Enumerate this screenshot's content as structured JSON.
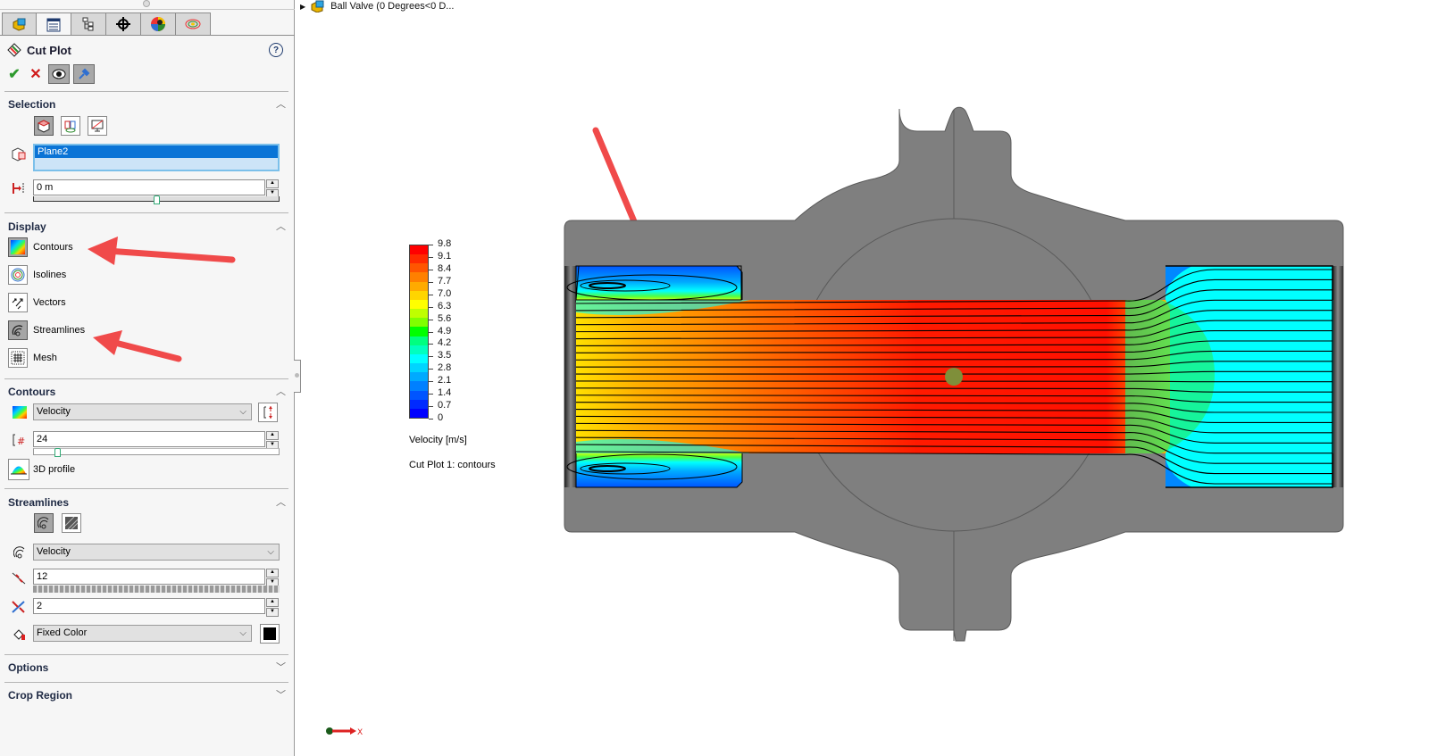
{
  "panel": {
    "tabs": [
      {
        "icon": "feature-manager-icon"
      },
      {
        "icon": "property-manager-icon",
        "active": true
      },
      {
        "icon": "configuration-manager-icon"
      },
      {
        "icon": "dimxpert-icon"
      },
      {
        "icon": "display-manager-icon"
      },
      {
        "icon": "flow-simulation-icon"
      }
    ],
    "title": "Cut Plot",
    "help_label": "?",
    "actions": {
      "ok": "✔",
      "cancel": "✕"
    },
    "selection": {
      "header": "Selection",
      "plane_value": "Plane2",
      "offset_value": "0 m",
      "offset_slider_fraction": 0.5
    },
    "display": {
      "header": "Display",
      "items": [
        {
          "label": "Contours",
          "active": true
        },
        {
          "label": "Isolines",
          "active": false
        },
        {
          "label": "Vectors",
          "active": false
        },
        {
          "label": "Streamlines",
          "active": true
        },
        {
          "label": "Mesh",
          "active": false
        }
      ]
    },
    "contours": {
      "header": "Contours",
      "parameter": "Velocity",
      "levels": "24",
      "levels_slider_fraction": 0.09,
      "profile_label": "3D profile"
    },
    "streamlines": {
      "header": "Streamlines",
      "parameter": "Velocity",
      "number_of_points": "12",
      "arrow_spacing": "2",
      "color_mode": "Fixed Color",
      "fixed_color": "#000000"
    },
    "options_header": "Options",
    "crop_header": "Crop Region"
  },
  "viewport": {
    "tree_label": "Ball Valve  (0 Degrees<0 D...",
    "legend": {
      "ticks": [
        "9.8",
        "9.1",
        "8.4",
        "7.7",
        "7.0",
        "6.3",
        "5.6",
        "4.9",
        "4.2",
        "3.5",
        "2.8",
        "2.1",
        "1.4",
        "0.7",
        "0"
      ],
      "colors": [
        "#ff0000",
        "#ff2a00",
        "#ff5500",
        "#ff8000",
        "#ffaa00",
        "#ffd500",
        "#ffff00",
        "#bfff00",
        "#80ff00",
        "#00ff00",
        "#00ff80",
        "#00ffbf",
        "#00ffff",
        "#00d5ff",
        "#00aaff",
        "#0080ff",
        "#0055ff",
        "#002aff",
        "#0000ff"
      ],
      "title": "Velocity [m/s]",
      "subtitle": "Cut Plot 1: contours",
      "min": 0,
      "max": 9.8
    },
    "triad_axis_label": "X",
    "annotation_color": "#f04a4a"
  }
}
